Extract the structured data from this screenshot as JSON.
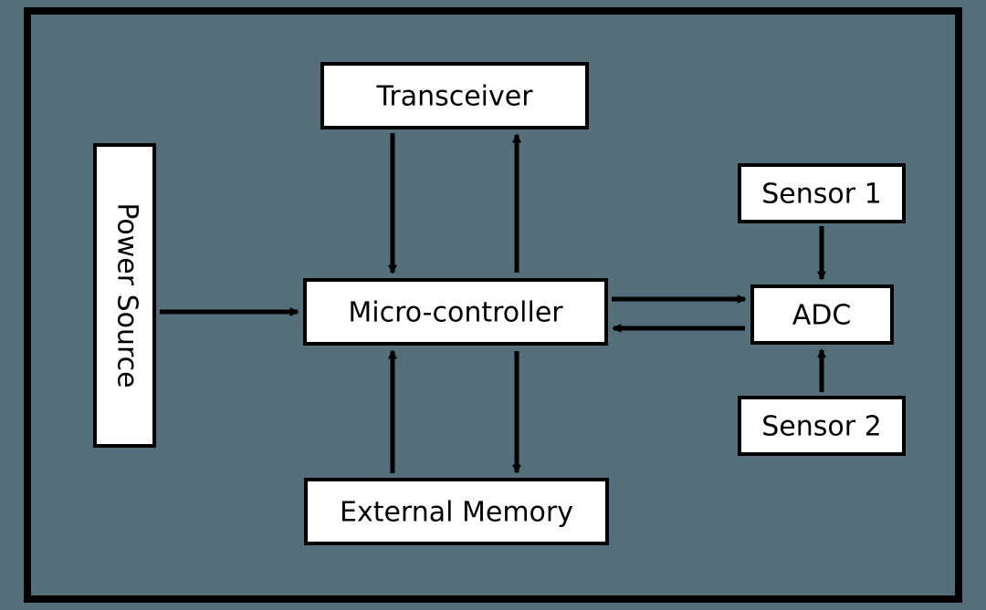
{
  "blocks": {
    "power": "Power Source",
    "trans": "Transceiver",
    "mcu": "Micro-controller",
    "extmem": "External Memory",
    "sensor1": "Sensor 1",
    "adc": "ADC",
    "sensor2": "Sensor 2"
  },
  "edges": [
    {
      "from": "power",
      "to": "mcu",
      "dir": "single"
    },
    {
      "from": "trans",
      "to": "mcu",
      "dir": "both"
    },
    {
      "from": "extmem",
      "to": "mcu",
      "dir": "both"
    },
    {
      "from": "mcu",
      "to": "adc",
      "dir": "both"
    },
    {
      "from": "sensor1",
      "to": "adc",
      "dir": "single"
    },
    {
      "from": "sensor2",
      "to": "adc",
      "dir": "single"
    }
  ]
}
